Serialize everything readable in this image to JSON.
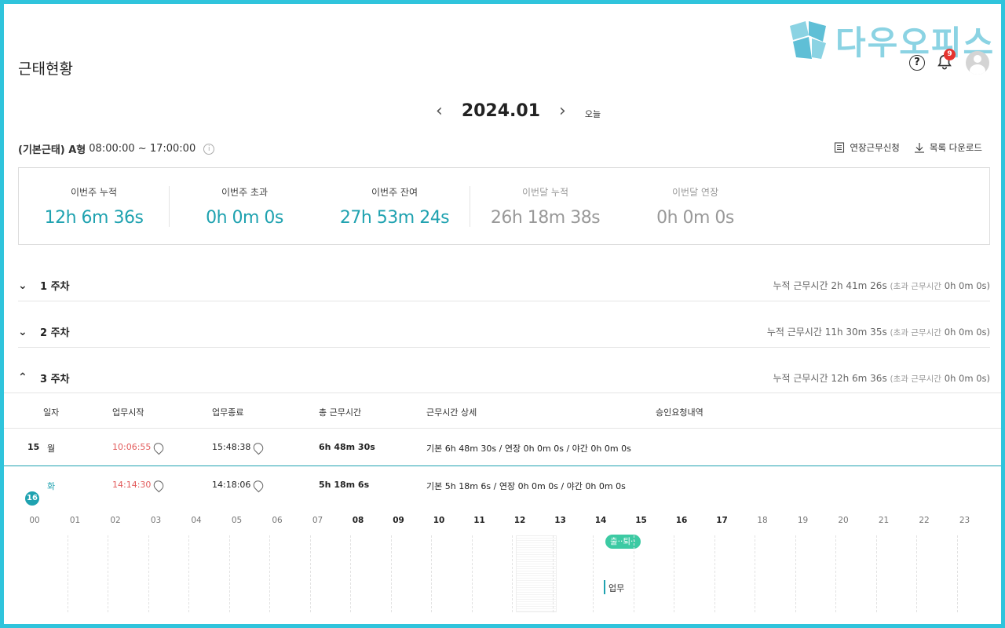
{
  "brand": {
    "name": "다우오피스",
    "accent": "#1fa2b0",
    "frame": "#2fc4dc"
  },
  "header": {
    "title": "근태현황",
    "notification_count": "9"
  },
  "month_nav": {
    "prev": "‹",
    "current": "2024.01",
    "next": "›",
    "today_label": "오늘"
  },
  "schedule": {
    "type_label": "(기본근태) A형",
    "hours": "08:00:00 ~ 17:00:00"
  },
  "actions": {
    "overtime_request": "연장근무신청",
    "download_list": "목록 다운로드"
  },
  "summary": [
    {
      "label": "이번주 누적",
      "value": "12h 6m 36s"
    },
    {
      "label": "이번주 초과",
      "value": "0h 0m 0s"
    },
    {
      "label": "이번주 잔여",
      "value": "27h 53m 24s"
    },
    {
      "label": "이번달 누적",
      "value": "26h 18m 38s"
    },
    {
      "label": "이번달 연장",
      "value": "0h 0m 0s"
    }
  ],
  "weeks": [
    {
      "label": "1 주차",
      "chev": "⌄",
      "sum_label": "누적 근무시간",
      "sum": "2h 41m 26s",
      "over_label": "(초과 근무시간",
      "over": "0h 0m 0s)"
    },
    {
      "label": "2 주차",
      "chev": "⌄",
      "sum_label": "누적 근무시간",
      "sum": "11h 30m 35s",
      "over_label": "(초과 근무시간",
      "over": "0h 0m 0s)"
    },
    {
      "label": "3 주차",
      "chev": "⌃",
      "sum_label": "누적 근무시간",
      "sum": "12h 6m 36s",
      "over_label": "(초과 근무시간",
      "over": "0h 0m 0s)"
    }
  ],
  "table": {
    "headers": {
      "date": "일자",
      "start": "업무시작",
      "end": "업무종료",
      "total": "총 근무시간",
      "detail": "근무시간 상세",
      "approval": "승인요청내역"
    },
    "rows": [
      {
        "day": "15",
        "weekday": "월",
        "start": "10:06:55",
        "end": "15:48:38",
        "total": "6h 48m 30s",
        "detail": "기본 6h 48m 30s / 연장 0h 0m 0s / 야간 0h 0m 0s"
      },
      {
        "day": "16",
        "weekday": "화",
        "start": "14:14:30",
        "end": "14:18:06",
        "total": "5h 18m 6s",
        "detail": "기본 5h 18m 6s / 연장 0h 0m 0s / 야간 0h 0m 0s"
      }
    ]
  },
  "timeline": {
    "hours": [
      "00",
      "01",
      "02",
      "03",
      "04",
      "05",
      "06",
      "07",
      "08",
      "09",
      "10",
      "11",
      "12",
      "13",
      "14",
      "15",
      "16",
      "17",
      "18",
      "19",
      "20",
      "21",
      "22",
      "23"
    ],
    "pill": "출··퇴··",
    "work_label": "업무"
  }
}
